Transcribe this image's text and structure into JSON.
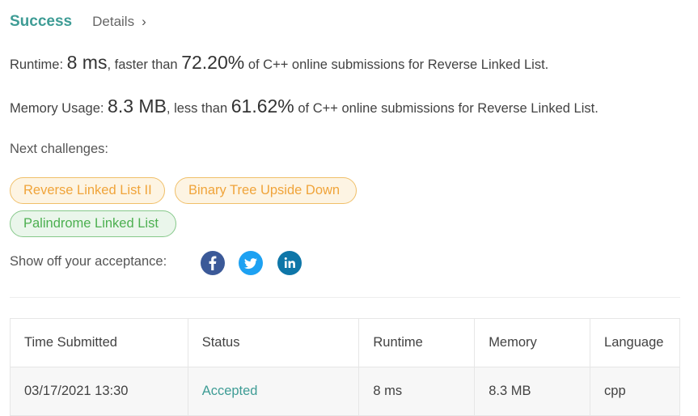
{
  "header": {
    "status": "Success",
    "details_label": "Details",
    "details_chevron": "›"
  },
  "runtime": {
    "label": "Runtime:",
    "value": "8 ms",
    "mid": ", faster than",
    "percent": "72.20%",
    "suffix": "of C++ online submissions for Reverse Linked List."
  },
  "memory": {
    "label": "Memory Usage:",
    "value": "8.3 MB",
    "mid": ", less than",
    "percent": "61.62%",
    "suffix": "of C++ online submissions for Reverse Linked List."
  },
  "next": {
    "label": "Next challenges:",
    "challenges": [
      {
        "label": "Reverse Linked List II",
        "color": "#f0a43a"
      },
      {
        "label": "Binary Tree Upside Down",
        "color": "#f0a43a"
      },
      {
        "label": "Palindrome Linked List",
        "color": "#4caf50"
      }
    ]
  },
  "share": {
    "label": "Show off your acceptance:",
    "icons": [
      "facebook-icon",
      "twitter-icon",
      "linkedin-icon"
    ],
    "colors": {
      "facebook": "#3b5998",
      "twitter": "#1da1f2",
      "linkedin": "#0e76a8"
    }
  },
  "table": {
    "headers": [
      "Time Submitted",
      "Status",
      "Runtime",
      "Memory",
      "Language"
    ],
    "rows": [
      [
        "03/17/2021 13:30",
        "Accepted",
        "8 ms",
        "8.3 MB",
        "cpp"
      ]
    ]
  },
  "colors": {
    "accent": "#3e9c95",
    "text": "#424242"
  }
}
